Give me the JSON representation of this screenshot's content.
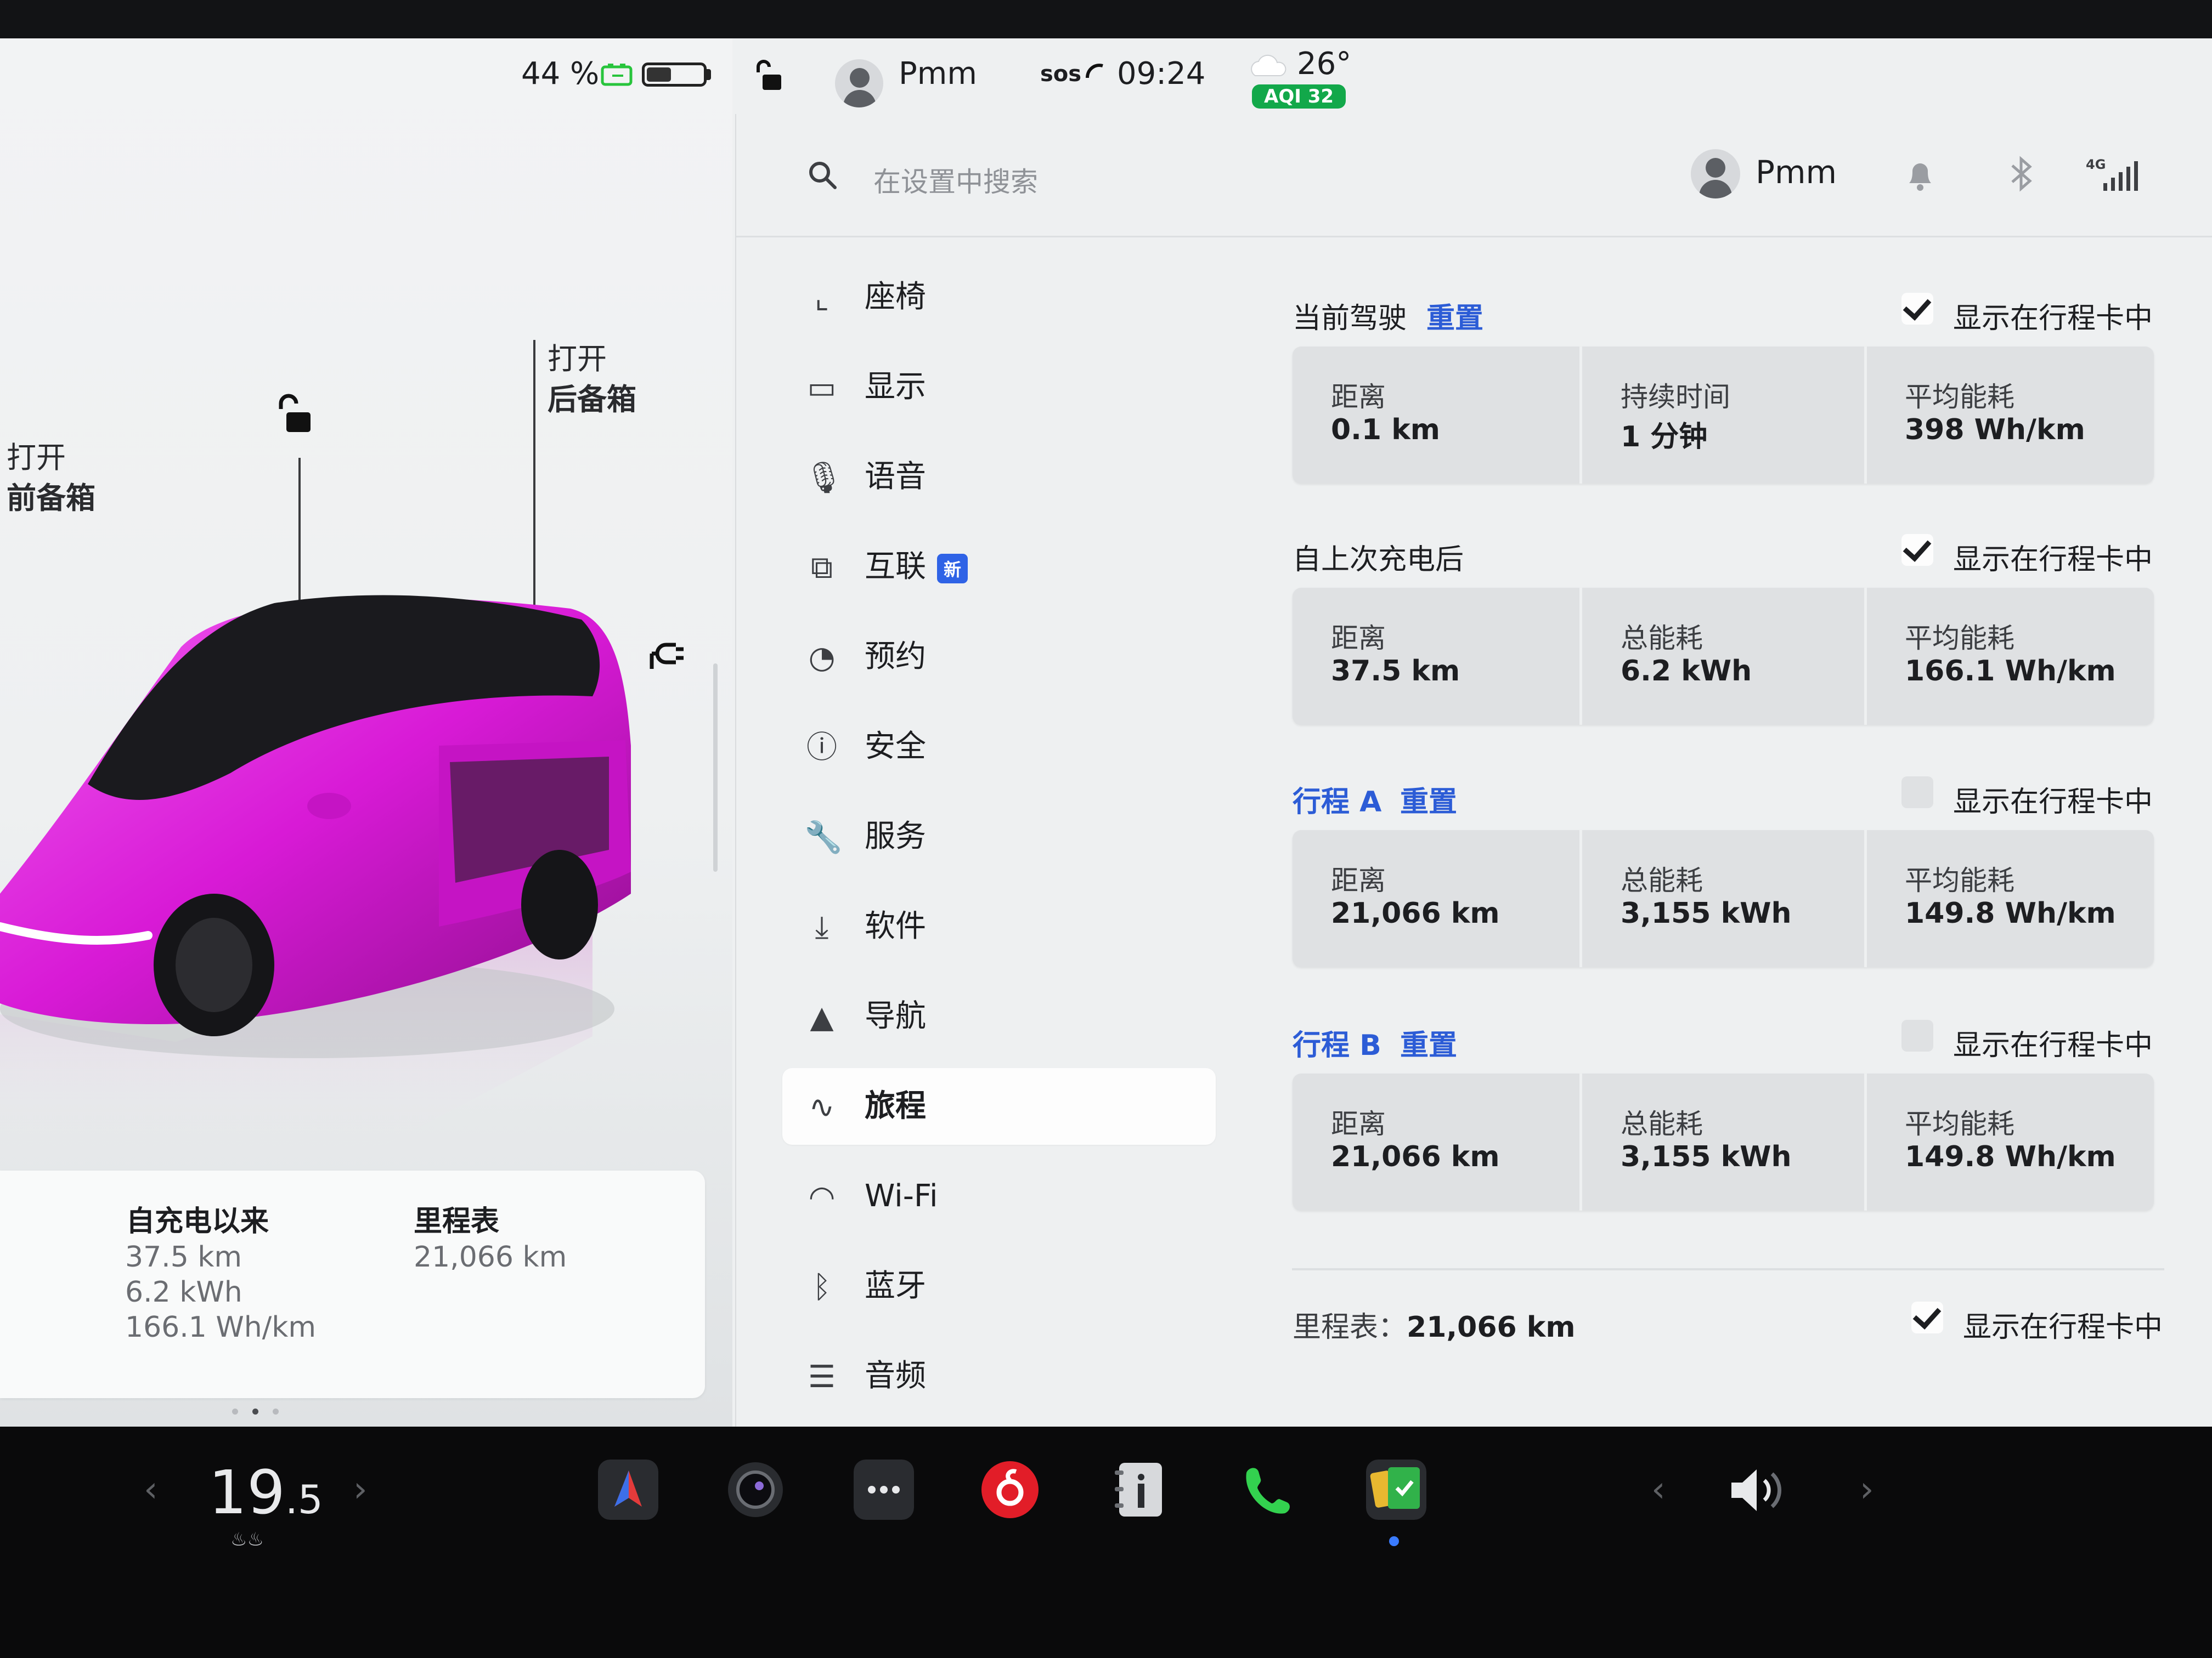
{
  "status_bar": {
    "battery_percent": "44 %",
    "battery_level": 0.44,
    "driver_name": "Pmm",
    "sos_label": "sos",
    "time": "09:24",
    "temperature": "26°",
    "aqi": "AQI 32"
  },
  "vehicle": {
    "frunk_action": "打开",
    "frunk_name": "前备箱",
    "trunk_action": "打开",
    "trunk_name": "后备箱",
    "car_color": "#d81ad6",
    "stats": {
      "since_charge_title": "自充电以来",
      "since_charge_distance": "37.5 km",
      "since_charge_energy": "6.2 kWh",
      "since_charge_avg": "166.1 Wh/km",
      "odometer_title": "里程表",
      "odometer_value": "21,066 km"
    }
  },
  "settings_header": {
    "search_placeholder": "在设置中搜索",
    "profile_name": "Pmm",
    "cell_label": "4G"
  },
  "nav": {
    "items": [
      {
        "icon": "seat-icon",
        "label": "座椅"
      },
      {
        "icon": "display-icon",
        "label": "显示"
      },
      {
        "icon": "microphone-icon",
        "label": "语音"
      },
      {
        "icon": "connect-icon",
        "label": "互联",
        "badge": "新"
      },
      {
        "icon": "schedule-icon",
        "label": "预约"
      },
      {
        "icon": "safety-icon",
        "label": "安全"
      },
      {
        "icon": "wrench-icon",
        "label": "服务"
      },
      {
        "icon": "download-icon",
        "label": "软件"
      },
      {
        "icon": "navigation-icon",
        "label": "导航"
      },
      {
        "icon": "trips-icon",
        "label": "旅程",
        "active": true
      },
      {
        "icon": "wifi-icon",
        "label": "Wi-Fi"
      },
      {
        "icon": "bluetooth-icon",
        "label": "蓝牙"
      },
      {
        "icon": "equalizer-icon",
        "label": "音频"
      }
    ]
  },
  "trips": {
    "current": {
      "title": "当前驾驶",
      "reset": "重置",
      "show_label": "显示在行程卡中",
      "checked": true,
      "cells": [
        {
          "label": "距离",
          "value": "0.1 km"
        },
        {
          "label": "持续时间",
          "value": "1 分钟"
        },
        {
          "label": "平均能耗",
          "value": "398  Wh/km"
        }
      ]
    },
    "since_charge": {
      "title": "自上次充电后",
      "show_label": "显示在行程卡中",
      "checked": true,
      "cells": [
        {
          "label": "距离",
          "value": "37.5 km"
        },
        {
          "label": "总能耗",
          "value": "6.2 kWh"
        },
        {
          "label": "平均能耗",
          "value": "166.1 Wh/km"
        }
      ]
    },
    "trip_a": {
      "title": "行程 A",
      "reset": "重置",
      "show_label": "显示在行程卡中",
      "checked": false,
      "cells": [
        {
          "label": "距离",
          "value": "21,066 km"
        },
        {
          "label": "总能耗",
          "value": "3,155 kWh"
        },
        {
          "label": "平均能耗",
          "value": "149.8 Wh/km"
        }
      ]
    },
    "trip_b": {
      "title": "行程 B",
      "reset": "重置",
      "show_label": "显示在行程卡中",
      "checked": false,
      "cells": [
        {
          "label": "距离",
          "value": "21,066 km"
        },
        {
          "label": "总能耗",
          "value": "3,155 kWh"
        },
        {
          "label": "平均能耗",
          "value": "149.8 Wh/km"
        }
      ]
    },
    "odometer": {
      "label": "里程表：",
      "value": "21,066 km",
      "show_label": "显示在行程卡中",
      "checked": true
    }
  },
  "dock": {
    "temp_main": "19",
    "temp_decimal": ".5",
    "apps": [
      "navigation-app-icon",
      "camera-app-icon",
      "more-apps-icon",
      "netease-music-app-icon",
      "manual-app-icon",
      "phone-app-icon",
      "calendar-app-icon"
    ],
    "volume_icon": "volume-icon"
  }
}
